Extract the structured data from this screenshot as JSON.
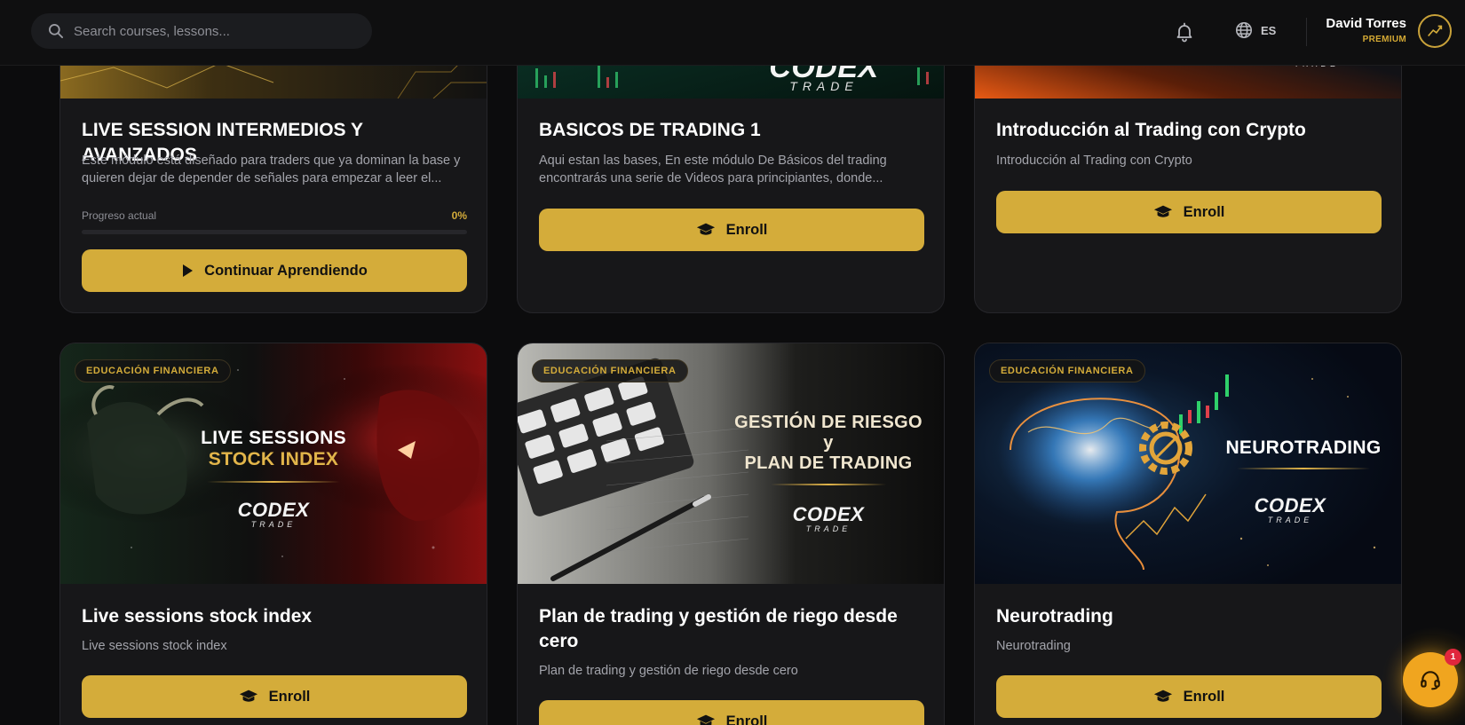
{
  "search": {
    "placeholder": "Search courses, lessons..."
  },
  "header": {
    "language": "ES"
  },
  "user": {
    "name": "David Torres",
    "tier": "PREMIUM"
  },
  "courses": [
    {
      "title": "LIVE SESSION INTERMEDIOS Y AVANZADOS",
      "description": "Este módulo está diseñado para traders que ya dominan la base y quieren dejar de depender de señales para empezar a leer el...",
      "progress_label": "Progreso actual",
      "progress_text": "0%",
      "progress": 0,
      "button": "Continuar Aprendiendo"
    },
    {
      "title": "BASICOS DE TRADING 1",
      "description": "Aqui estan las bases, En este módulo De Básicos del trading encontrarás una serie de Videos para principiantes, donde...",
      "button": "Enroll",
      "art_logo": "CODEX",
      "art_logo_sub": "TRADE"
    },
    {
      "title": "Introducción al Trading con Crypto",
      "description": "Introducción al Trading con Crypto",
      "button": "Enroll",
      "art_logo_sub": "TRADE"
    },
    {
      "badge": "EDUCACIÓN FINANCIERA",
      "art_line1": "LIVE SESSIONS",
      "art_line2": "STOCK INDEX",
      "art_logo": "CODEX",
      "art_logo_sub": "TRADE",
      "title": "Live sessions stock index",
      "description": "Live sessions stock index",
      "button": "Enroll"
    },
    {
      "badge": "EDUCACIÓN FINANCIERA",
      "art_line1": "GESTIÓN DE RIESGO",
      "art_line2": "y",
      "art_line3": "PLAN DE TRADING",
      "art_logo": "CODEX",
      "art_logo_sub": "TRADE",
      "title": "Plan de trading y gestión de riego desde cero",
      "description": "Plan de trading y gestión de riego desde cero",
      "button": "Enroll"
    },
    {
      "badge": "EDUCACIÓN FINANCIERA",
      "art_line1": "NEUROTRADING",
      "art_logo": "CODEX",
      "art_logo_sub": "TRADE",
      "title": "Neurotrading",
      "description": "Neurotrading",
      "button": "Enroll"
    }
  ],
  "chat": {
    "count": "1"
  },
  "colors": {
    "accent": "#d4ac3a",
    "background": "#0c0c0d",
    "card": "#171719",
    "chat": "#f0a51f",
    "alert": "#e0263d"
  }
}
